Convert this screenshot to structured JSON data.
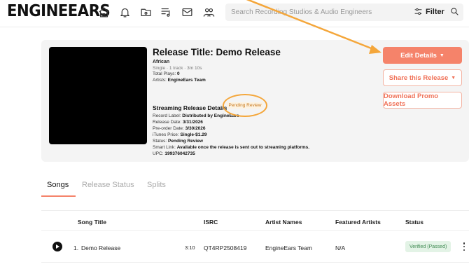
{
  "header": {
    "logo_text": "ENGINEEARS",
    "nav_icons": [
      "home-icon",
      "bell-icon",
      "folder-icon",
      "playlist-icon",
      "mail-icon",
      "people-icon"
    ],
    "search_placeholder": "Search Recording Studios & Audio Engineers",
    "filter_label": "Filter"
  },
  "release": {
    "title": "Release Title: Demo Release",
    "genre": "African",
    "meta": "Single · 1 track · 3m 10s",
    "total_plays_label": "Total Plays: ",
    "total_plays_value": "0",
    "artists_label": "Artists: ",
    "artists_value": "EngineEars Team",
    "streaming_title": "Streaming Release Details",
    "status_badge": "Pending Review",
    "record_label_label": "Record Label: ",
    "record_label_value": "Distributed by EngineEars",
    "release_date_label": "Release Date: ",
    "release_date_value": "3/31/2026",
    "preorder_date_label": "Pre-order Date: ",
    "preorder_date_value": "3/30/2026",
    "itunes_price_label": "iTunes Price: ",
    "itunes_price_value": "Single-$1.29",
    "status_label": "Status: ",
    "status_value": "Pending Review",
    "smart_link_label": "Smart Link: ",
    "smart_link_value": "Available once the release is sent out to streaming platforms.",
    "upc_label": "UPC: ",
    "upc_value": "199376042735"
  },
  "actions": {
    "edit_details": "Edit Details",
    "share_release": "Share this Release",
    "download_promo": "Download Promo Assets"
  },
  "tabs": [
    "Songs",
    "Release Status",
    "Splits"
  ],
  "active_tab": "Songs",
  "table": {
    "headers": [
      "Song Title",
      "ISRC",
      "Artist Names",
      "Featured Artists",
      "Status"
    ],
    "rows": [
      {
        "index": "1.",
        "title": "Demo Release",
        "duration": "3:10",
        "isrc": "QT4RP2508419",
        "artists": "EngineEars Team",
        "featured": "N/A",
        "status": "Verified (Passed)"
      }
    ]
  },
  "colors": {
    "accent": "#f5836a",
    "annotation": "#f4a63a",
    "verified_bg": "#e3f3e6",
    "verified_text": "#3f8a52"
  }
}
